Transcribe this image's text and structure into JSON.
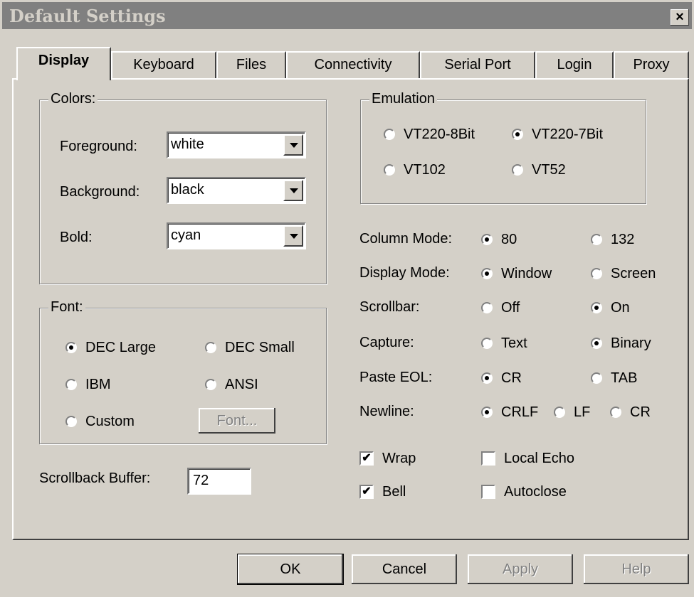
{
  "title": "Default Settings",
  "close_label": "×",
  "tabs": [
    {
      "label": "Display"
    },
    {
      "label": "Keyboard"
    },
    {
      "label": "Files"
    },
    {
      "label": "Connectivity"
    },
    {
      "label": "Serial Port"
    },
    {
      "label": "Login"
    },
    {
      "label": "Proxy"
    }
  ],
  "colors": {
    "legend": "Colors:",
    "foreground": {
      "label": "Foreground:",
      "value": "white"
    },
    "background": {
      "label": "Background:",
      "value": "black"
    },
    "bold": {
      "label": "Bold:",
      "value": "cyan"
    }
  },
  "font": {
    "legend": "Font:",
    "options": [
      {
        "label": "DEC Large",
        "selected": true
      },
      {
        "label": "DEC Small",
        "selected": false
      },
      {
        "label": "IBM",
        "selected": false
      },
      {
        "label": "ANSI",
        "selected": false
      },
      {
        "label": "Custom",
        "selected": false
      }
    ],
    "font_button": "Font..."
  },
  "scrollback": {
    "label": "Scrollback Buffer:",
    "value": "72"
  },
  "emulation": {
    "legend": "Emulation",
    "options": [
      {
        "label": "VT220-8Bit",
        "selected": false
      },
      {
        "label": "VT220-7Bit",
        "selected": true
      },
      {
        "label": "VT102",
        "selected": false
      },
      {
        "label": "VT52",
        "selected": false
      }
    ]
  },
  "settings": {
    "column_mode": {
      "label": "Column Mode:",
      "opt1": "80",
      "opt2": "132",
      "selected": "80"
    },
    "display_mode": {
      "label": "Display Mode:",
      "opt1": "Window",
      "opt2": "Screen",
      "selected": "Window"
    },
    "scrollbar": {
      "label": "Scrollbar:",
      "opt1": "Off",
      "opt2": "On",
      "selected": "On"
    },
    "capture": {
      "label": "Capture:",
      "opt1": "Text",
      "opt2": "Binary",
      "selected": "Binary"
    },
    "paste_eol": {
      "label": "Paste EOL:",
      "opt1": "CR",
      "opt2": "TAB",
      "selected": "CR"
    },
    "newline": {
      "label": "Newline:",
      "opt1": "CRLF",
      "opt2": "LF",
      "opt3": "CR",
      "selected": "CRLF"
    }
  },
  "checks": {
    "wrap": {
      "label": "Wrap",
      "checked": true
    },
    "local_echo": {
      "label": "Local Echo",
      "checked": false
    },
    "bell": {
      "label": "Bell",
      "checked": true
    },
    "autoclose": {
      "label": "Autoclose",
      "checked": false
    }
  },
  "check_mark": "✔",
  "buttons": {
    "ok": "OK",
    "cancel": "Cancel",
    "apply": "Apply",
    "help": "Help"
  }
}
